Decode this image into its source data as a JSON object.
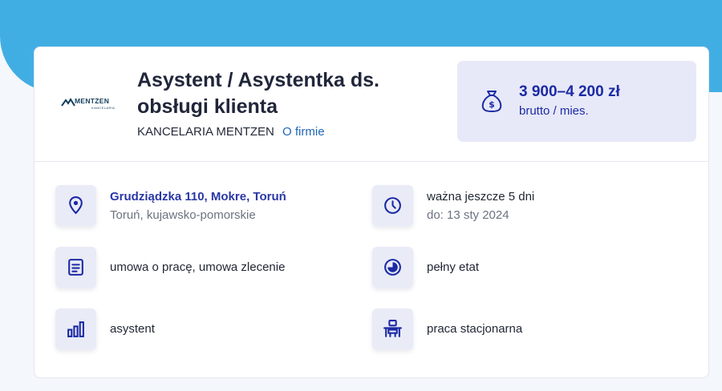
{
  "company": {
    "logo": {
      "word": "MENTZEN",
      "sub": "KANCELARIA"
    },
    "name": "KANCELARIA MENTZEN",
    "about_link": "O firmie"
  },
  "job": {
    "title": "Asystent / Asystentka ds. obsługi klienta"
  },
  "salary": {
    "amount": "3 900–4 200 zł",
    "period": "brutto / mies.",
    "icon": "money-bag-icon"
  },
  "details": {
    "location": {
      "address": "Grudziądzka 110, Mokre, Toruń",
      "region": "Toruń, kujawsko-pomorskie",
      "icon": "location-pin-icon"
    },
    "validity": {
      "remaining": "ważna jeszcze 5 dni",
      "until": "do: 13 sty 2024",
      "icon": "clock-icon"
    },
    "contract": {
      "text": "umowa o pracę, umowa zlecenie",
      "icon": "document-icon"
    },
    "worktime": {
      "text": "pełny etat",
      "icon": "pie-chart-icon"
    },
    "level": {
      "text": "asystent",
      "icon": "bar-chart-icon"
    },
    "mode": {
      "text": "praca stacjonarna",
      "icon": "desk-icon"
    }
  },
  "colors": {
    "top_background": "#41aee3",
    "accent": "#1c2aa4",
    "link": "#2167b6",
    "icon_box": "#e9ebf7"
  }
}
